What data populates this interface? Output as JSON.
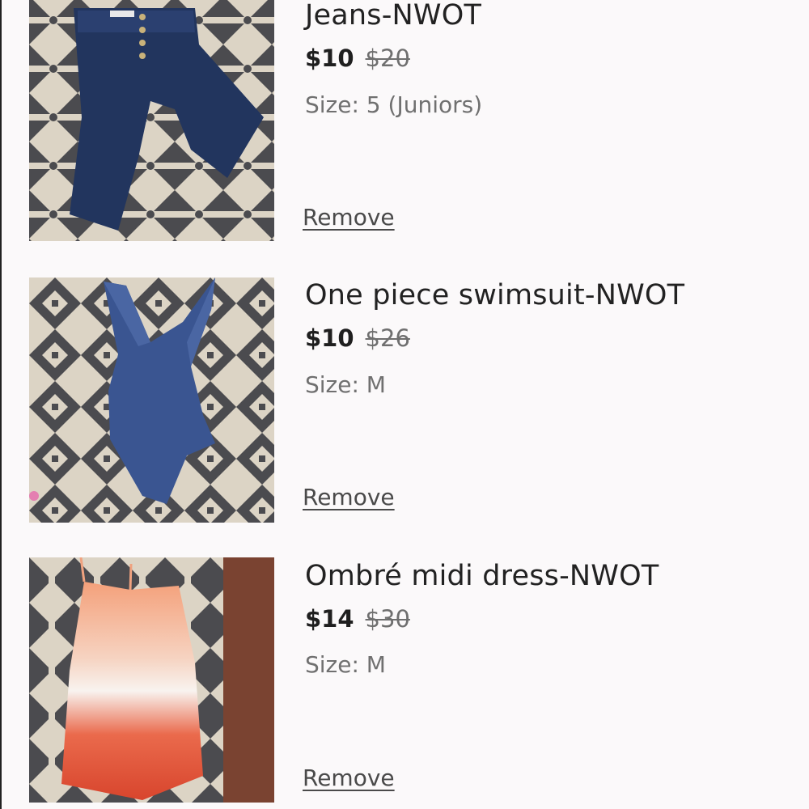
{
  "cart": {
    "items": [
      {
        "title": "Jeans-NWOT",
        "price": "$10",
        "original_price": "$20",
        "size": "Size: 5 (Juniors)",
        "remove_label": "Remove",
        "image": "denim-jeans-photo"
      },
      {
        "title": "One piece swimsuit-NWOT",
        "price": "$10",
        "original_price": "$26",
        "size": "Size: M",
        "remove_label": "Remove",
        "image": "navy-swimsuit-photo"
      },
      {
        "title": "Ombré midi dress-NWOT",
        "price": "$14",
        "original_price": "$30",
        "size": "Size: M",
        "remove_label": "Remove",
        "image": "ombre-dress-photo"
      }
    ]
  },
  "colors": {
    "background": "#fbf9fa",
    "text": "#222222",
    "muted": "#707070",
    "rug_dark": "#4a4a4d",
    "rug_light": "#ddd5c6"
  }
}
